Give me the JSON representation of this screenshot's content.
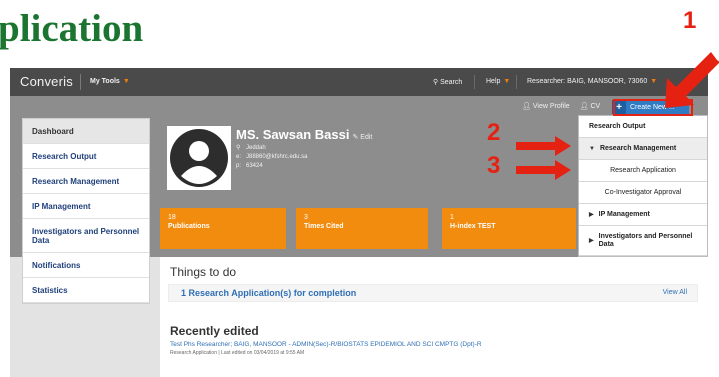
{
  "doc_title": "plication",
  "steps": [
    "1",
    "2",
    "3"
  ],
  "topnav": {
    "brand": "Converis",
    "my_tools": "My Tools",
    "search": "Search",
    "help": "Help",
    "researcher": "Researcher: BAIG, MANSOOR, 73060"
  },
  "header_links": {
    "view_profile": "View Profile",
    "cv": "CV",
    "create_new": "Create New ..."
  },
  "sidebar": {
    "items": [
      {
        "label": "Dashboard"
      },
      {
        "label": "Research Output"
      },
      {
        "label": "Research Management"
      },
      {
        "label": "IP Management"
      },
      {
        "label": "Investigators and Personnel Data"
      },
      {
        "label": "Notifications"
      },
      {
        "label": "Statistics"
      }
    ]
  },
  "profile": {
    "name": "MS. Sawsan Bassi",
    "edit": "Edit",
    "location": "Jeddah",
    "email_key": "e:",
    "email": "J88860@kfshrc.edu.sa",
    "phone_key": "p:",
    "phone": "63424"
  },
  "tiles": [
    {
      "number": "18",
      "label": "Publications"
    },
    {
      "number": "3",
      "label": "Times Cited"
    },
    {
      "number": "1",
      "label": "H-index TEST"
    }
  ],
  "things_to_do": {
    "heading": "Things to do",
    "item": "1 Research Application(s) for completion",
    "view_all": "View All"
  },
  "recently_edited": {
    "heading": "Recently edited",
    "link": "Test Phs Researcher; BAIG, MANSOOR - ADMIN(Sec)-R/BIOSTATS EPIDEMIOL AND SCI CMPTG (Dpt)-R",
    "meta": "Research Application | Last edited on 03/04/2019 at 9:55 AM"
  },
  "dropdown": {
    "research_output": "Research Output",
    "research_management": "Research Management",
    "research_application": "Research Application",
    "co_investigator": "Co-Investigator Approval",
    "ip_management": "IP Management",
    "investigators": "Investigators and Personnel Data"
  },
  "colors": {
    "title_green": "#1b7530",
    "annotation_red": "#e52212",
    "tile_orange": "#f28c0f",
    "link_blue": "#2f6fb5",
    "topnav": "#4a4a4a"
  }
}
